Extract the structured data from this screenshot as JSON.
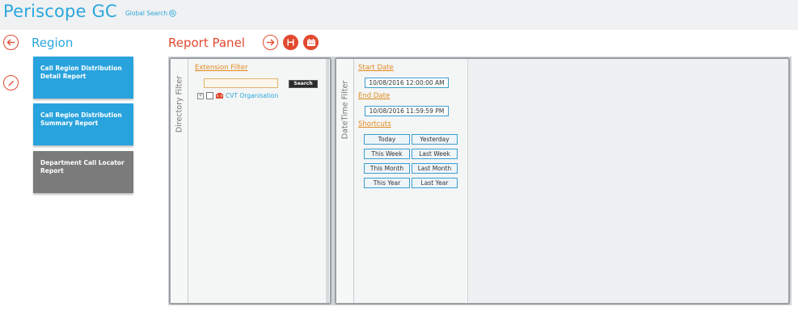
{
  "header": {
    "app_title": "Periscope GC",
    "global_search_label": "Global Search"
  },
  "left": {
    "section_title": "Region",
    "reports": [
      {
        "line1": "Call Region Distribution",
        "line2": "Detail Report"
      },
      {
        "line1": "Call Region Distribution",
        "line2": "Summary Report"
      },
      {
        "line1": "Department Call Locator",
        "line2": "Report"
      }
    ]
  },
  "report_panel": {
    "title": "Report Panel",
    "directory_filter": {
      "tab_label": "Directory Filter",
      "extension_filter_label": "Extension Filter",
      "search_value": "",
      "search_button": "Search",
      "tree_root": "CVT Organisation"
    },
    "datetime_filter": {
      "tab_label": "DateTime Filter",
      "start_date_label": "Start Date",
      "start_date_value": "10/08/2016 12:00:00 AM",
      "end_date_label": "End Date",
      "end_date_value": "10/08/2016 11:59:59 PM",
      "shortcuts_label": "Shortcuts",
      "shortcuts": [
        "Today",
        "Yesterday",
        "This Week",
        "Last Week",
        "This Month",
        "Last Month",
        "This Year",
        "Last Year"
      ]
    }
  },
  "colors": {
    "accent_blue": "#2aa7de",
    "accent_red": "#e24a30",
    "link_orange": "#e08a1e",
    "tile_gray": "#7b7b7b"
  },
  "icons": [
    "search-icon",
    "back-arrow-icon",
    "edit-pencil-icon",
    "forward-arrow-icon",
    "save-icon",
    "schedule-icon",
    "org-icon"
  ]
}
